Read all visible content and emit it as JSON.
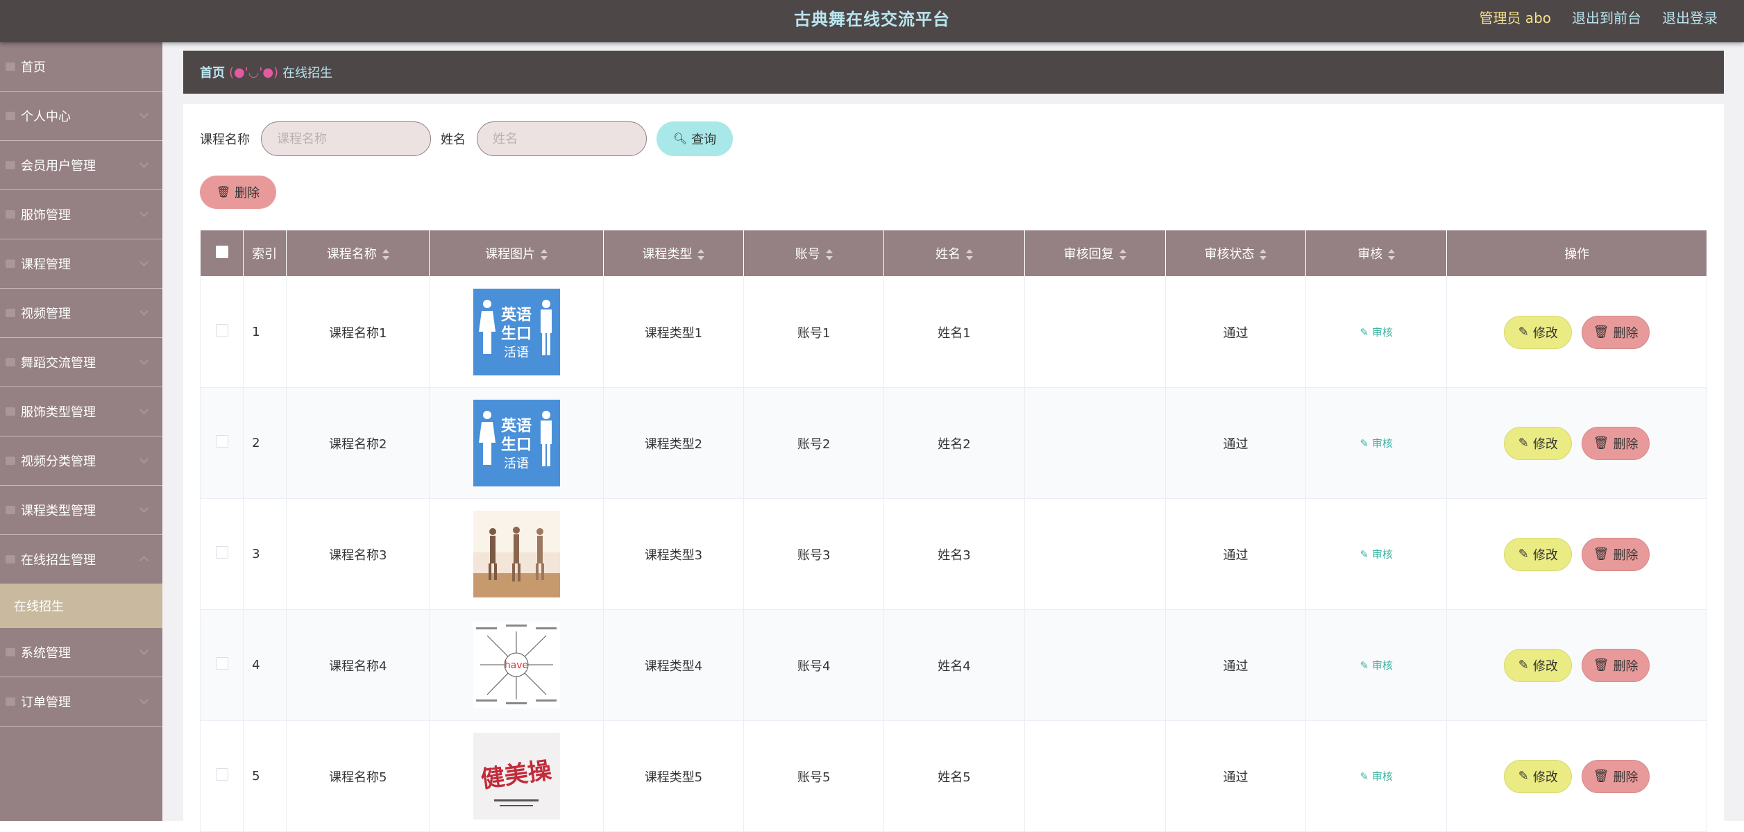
{
  "header": {
    "title": "古典舞在线交流平台",
    "admin_label": "管理员 abo",
    "to_front": "退出到前台",
    "logout": "退出登录"
  },
  "sidebar": {
    "items": [
      {
        "label": "首页"
      },
      {
        "label": "个人中心"
      },
      {
        "label": "会员用户管理"
      },
      {
        "label": "服饰管理"
      },
      {
        "label": "课程管理"
      },
      {
        "label": "视频管理"
      },
      {
        "label": "舞蹈交流管理"
      },
      {
        "label": "服饰类型管理"
      },
      {
        "label": "视频分类管理"
      },
      {
        "label": "课程类型管理"
      },
      {
        "label": "在线招生管理"
      }
    ],
    "active_sub": "在线招生",
    "after": [
      {
        "label": "系统管理"
      },
      {
        "label": "订单管理"
      }
    ]
  },
  "breadcrumb": {
    "home": "首页",
    "face": "(●'◡'●)",
    "current": "在线招生"
  },
  "search": {
    "course_label": "课程名称",
    "course_placeholder": "课程名称",
    "name_label": "姓名",
    "name_placeholder": "姓名",
    "query_button": "查询"
  },
  "toolbar": {
    "delete_button": "删除"
  },
  "table": {
    "headers": [
      "索引",
      "课程名称",
      "课程图片",
      "课程类型",
      "账号",
      "姓名",
      "审核回复",
      "审核状态",
      "审核",
      "操作"
    ],
    "rows": [
      {
        "index": "1",
        "course": "课程名称1",
        "type": "课程类型1",
        "account": "账号1",
        "name": "姓名1",
        "reply": "",
        "status": "通过",
        "audit": "审核",
        "image": "english-speaking"
      },
      {
        "index": "2",
        "course": "课程名称2",
        "type": "课程类型2",
        "account": "账号2",
        "name": "姓名2",
        "reply": "",
        "status": "通过",
        "audit": "审核",
        "image": "english-speaking"
      },
      {
        "index": "3",
        "course": "课程名称3",
        "type": "课程类型3",
        "account": "账号3",
        "name": "姓名3",
        "reply": "",
        "status": "通过",
        "audit": "审核",
        "image": "dancers-photo"
      },
      {
        "index": "4",
        "course": "课程名称4",
        "type": "课程类型4",
        "account": "账号4",
        "name": "姓名4",
        "reply": "",
        "status": "通过",
        "audit": "审核",
        "image": "have-mindmap"
      },
      {
        "index": "5",
        "course": "课程名称5",
        "type": "课程类型5",
        "account": "账号5",
        "name": "姓名5",
        "reply": "",
        "status": "通过",
        "audit": "审核",
        "image": "fitness-calligraphy"
      }
    ],
    "edit_label": "修改",
    "delete_label": "删除"
  },
  "images": {
    "english_line1": "英语",
    "english_line2": "生口",
    "english_line3": "活语",
    "mindmap_word": "have",
    "calligraphy": "健美操"
  },
  "colors": {
    "header_bg": "#4e4748",
    "sidebar_bg": "#958083",
    "accent_cyan": "#b9e6ef",
    "query_btn": "#a8e8e8",
    "edit_btn": "#ebeb84",
    "delete_btn": "#e89a9a"
  }
}
